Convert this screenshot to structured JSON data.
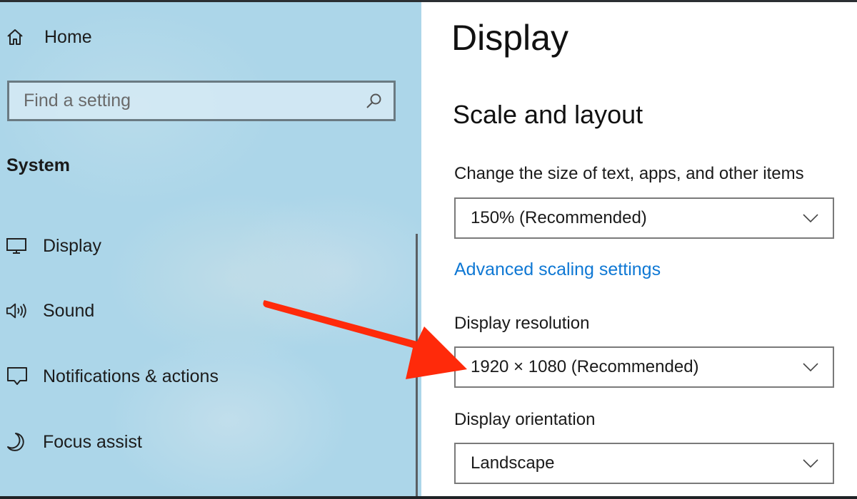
{
  "sidebar": {
    "home_label": "Home",
    "search_placeholder": "Find a setting",
    "section_title": "System",
    "items": [
      {
        "label": "Display",
        "icon": "monitor-icon"
      },
      {
        "label": "Sound",
        "icon": "speaker-icon"
      },
      {
        "label": "Notifications & actions",
        "icon": "notification-icon"
      },
      {
        "label": "Focus assist",
        "icon": "moon-icon"
      }
    ]
  },
  "main": {
    "title": "Display",
    "section": "Scale and layout",
    "scale": {
      "label": "Change the size of text, apps, and other items",
      "value": "150% (Recommended)"
    },
    "advanced_link": "Advanced scaling settings",
    "resolution": {
      "label": "Display resolution",
      "value": "1920 × 1080 (Recommended)"
    },
    "orientation": {
      "label": "Display orientation",
      "value": "Landscape"
    }
  },
  "annotation": {
    "type": "arrow",
    "color": "#ff2a0a",
    "points_to": "display-resolution-dropdown"
  },
  "colors": {
    "sidebar_bg": "#acd6e9",
    "link": "#0f78d4"
  }
}
